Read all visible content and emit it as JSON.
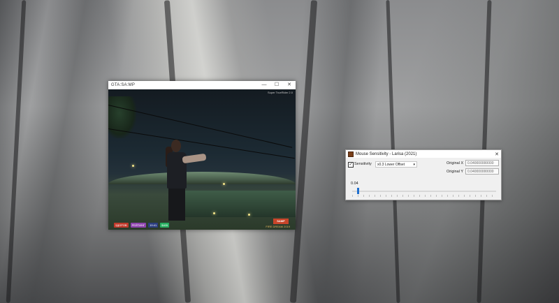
{
  "game_window": {
    "title": "GTA:SA:MP",
    "minimize_icon": "minimize-icon",
    "maximize_icon": "maximize-icon",
    "close_icon": "close-icon",
    "controls": {
      "minimize": "—",
      "maximize": "☐",
      "close": "✕"
    },
    "top_right_text": "Super TrueRider 2.0",
    "hud": {
      "chips": [
        {
          "text": "ЗДОРОВ",
          "color": "#c0392b"
        },
        {
          "text": "РЕЙТИНГ",
          "color": "#8e44ad"
        },
        {
          "text": "19:41",
          "color": "#2c3e80"
        },
        {
          "text": "$405",
          "color": "#27ae60"
        }
      ],
      "logo": "SAMP",
      "subtitle": "FIRE DREAM 2019"
    }
  },
  "sensitivity_window": {
    "title": "Mouse Sensitivity - Larisa (2021)",
    "close_label": "✕",
    "checkbox": {
      "label": "Sensitivity",
      "checked": true,
      "mark": "✓"
    },
    "combo": {
      "value": "x0.3 Lower Offset",
      "arrow": "▾"
    },
    "original_x": {
      "label": "Original X",
      "value": "0.040000000000"
    },
    "original_y": {
      "label": "Original Y",
      "value": "0.040000000000"
    },
    "slider": {
      "label": "0.04",
      "value": 0.04,
      "min": 0,
      "max": 1
    }
  },
  "colors": {
    "accent": "#1f6fcf",
    "window_bg": "#f0f0f0",
    "titlebar": "#ffffff"
  }
}
